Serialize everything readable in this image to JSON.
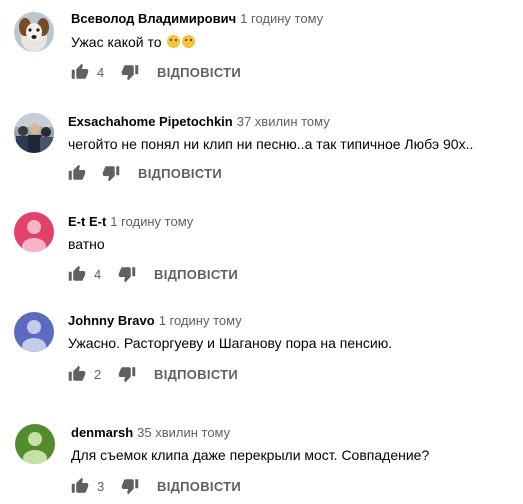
{
  "comments": [
    {
      "author": "Всеволод Владимирович",
      "time": "1 годину тому",
      "text": "Ужас какой то",
      "emoji": [
        "weeping-laughing-emoji",
        "astonished-emoji"
      ],
      "likes": "4",
      "reply_label": "ВІДПОВІСТИ",
      "avatar": "dog-photo"
    },
    {
      "author": "Exsachahome Pipetochkin",
      "time": "37 хвилин тому",
      "text": "чегойто не понял ни клип ни песню..а так типичное Любэ 90х..",
      "likes": "",
      "reply_label": "ВІДПОВІСТИ",
      "avatar": "crowd-photo"
    },
    {
      "author": "E-t E-t",
      "time": "1 годину тому",
      "text": "ватно",
      "likes": "4",
      "reply_label": "ВІДПОВІСТИ",
      "avatar": "default-user",
      "avatar_color": "#e2416b"
    },
    {
      "author": "Johnny Bravo",
      "time": "1 годину тому",
      "text": "Ужасно. Расторгуеву и Шаганову пора на пенсию.",
      "likes": "2",
      "reply_label": "ВІДПОВІСТИ",
      "avatar": "default-user",
      "avatar_color": "#5c6bc0"
    },
    {
      "author": "denmarsh",
      "time": "35 хвилин тому",
      "text": "Для съемок клипа даже перекрыли мост. Совпадение?",
      "likes": "3",
      "reply_label": "ВІДПОВІСТИ",
      "avatar": "default-user",
      "avatar_color": "#558b2f"
    }
  ],
  "colors": {
    "author": "#030303",
    "meta": "#606060"
  }
}
